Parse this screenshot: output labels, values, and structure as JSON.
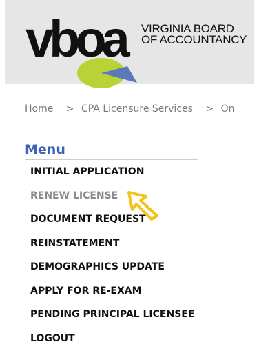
{
  "header": {
    "logo_mark": "vboa",
    "logo_line1": "VIRGINIA BOARD",
    "logo_line2": "OF ACCOUNTANCY",
    "colors": {
      "background": "#e6e6e6",
      "lime": "#b9d236",
      "blue": "#5a79b9"
    }
  },
  "breadcrumb": {
    "items": [
      "Home",
      "CPA Licensure Services",
      "On"
    ],
    "separator": ">"
  },
  "menu": {
    "title": "Menu",
    "items": [
      {
        "label": "INITIAL APPLICATION"
      },
      {
        "label": "RENEW LICENSE",
        "state": "hover"
      },
      {
        "label": "DOCUMENT REQUEST"
      },
      {
        "label": "REINSTATEMENT"
      },
      {
        "label": "DEMOGRAPHICS UPDATE"
      },
      {
        "label": "APPLY FOR RE-EXAM"
      },
      {
        "label": "PENDING PRINCIPAL LICENSEE"
      },
      {
        "label": "LOGOUT"
      }
    ]
  },
  "cursor": {
    "icon": "pointer-arrow-icon",
    "color": "#f5c21a"
  }
}
